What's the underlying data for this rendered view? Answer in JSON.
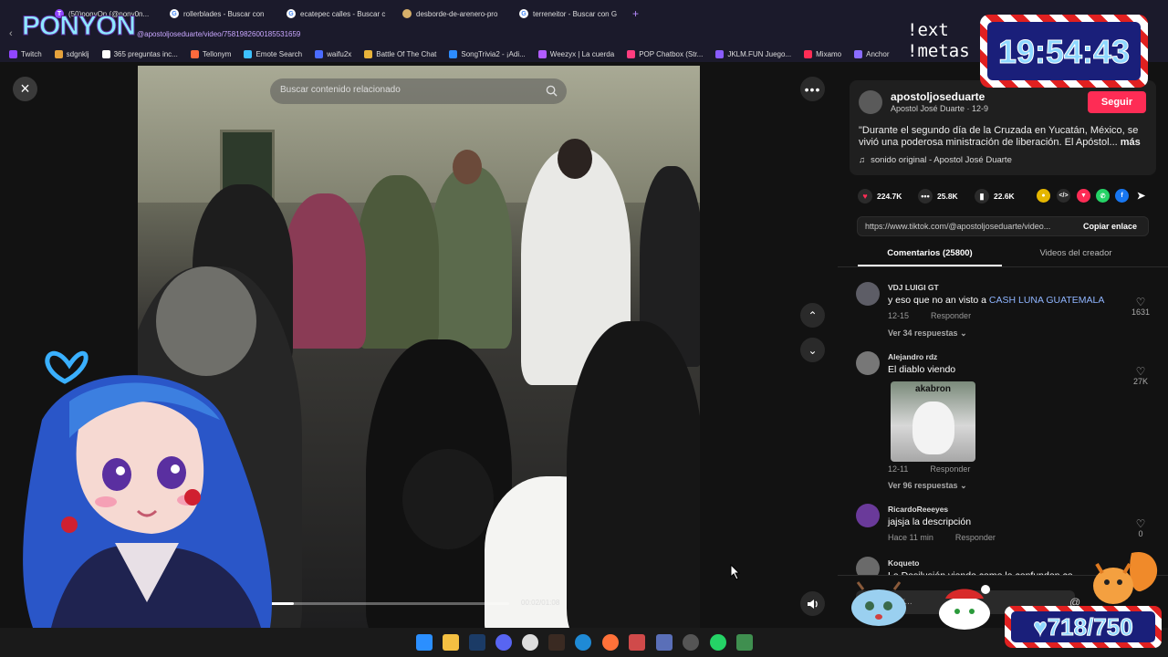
{
  "browser": {
    "tabs": [
      {
        "label": "(50)ponyOn (@pony0n..."
      },
      {
        "label": "rollerblades - Buscar con"
      },
      {
        "label": "ecatepec calles - Buscar c"
      },
      {
        "label": "desborde-de-arenero-pro"
      },
      {
        "label": "terreneitor - Buscar con G"
      }
    ],
    "url": "@apostoljoseduarte/video/7581982600185531659",
    "bookmarks": [
      {
        "label": "Twitch",
        "color": "#9146ff"
      },
      {
        "label": "sdgnklj",
        "color": "#e6a23c"
      },
      {
        "label": "365 preguntas inc...",
        "color": "#ffffff"
      },
      {
        "label": "Tellonym",
        "color": "#ff6a3d"
      },
      {
        "label": "Emote Search",
        "color": "#3dc1ff"
      },
      {
        "label": "waifu2x",
        "color": "#4b6cff"
      },
      {
        "label": "Battle Of The Chat",
        "color": "#e8b33a"
      },
      {
        "label": "SongTrivia2 - ¡Adi...",
        "color": "#2d8cff"
      },
      {
        "label": "Weezyx | La cuerda",
        "color": "#b25cff"
      },
      {
        "label": "POP Chatbox (Str...",
        "color": "#ff3d7f"
      },
      {
        "label": "JKLM.FUN Juego...",
        "color": "#8a5cff"
      },
      {
        "label": "Mixamo",
        "color": "#ff2d55"
      },
      {
        "label": "Anchor",
        "color": "#8a6cff"
      }
    ]
  },
  "overlay": {
    "logo": "PONYON",
    "cmd_line1": "!ext",
    "cmd_line2": "!metas",
    "clock": "19:54:43",
    "counter": "718/750"
  },
  "player": {
    "search_placeholder": "Buscar contenido relacionado",
    "time": "00:02/01:08",
    "progress": 0.1
  },
  "post": {
    "handle": "apostoljoseduarte",
    "subline": "Apostol José Duarte · 12-9",
    "follow_label": "Seguir",
    "description": "\"Durante el segundo día de la Cruzada en Yucatán, México, se vivió una poderosa ministración de liberación. El Apóstol...",
    "more_label": "más",
    "sound": "sonido original - Apostol José Duarte",
    "likes": "224.7K",
    "comments": "25.8K",
    "saves": "22.6K",
    "link": "https://www.tiktok.com/@apostoljoseduarte/video...",
    "copy_label": "Copiar enlace",
    "tab_comments": "Comentarios (25800)",
    "tab_videos": "Videos del creador"
  },
  "comments": [
    {
      "user": "VDJ LUIGI GT",
      "text": "y eso que no an visto a ",
      "link": "CASH LUNA GUATEMALA",
      "date": "12-15",
      "reply": "Responder",
      "likes": "1631",
      "replies": "Ver 34 respuestas"
    },
    {
      "user": "Alejandro rdz",
      "text": "El diablo viendo",
      "meme": "akabron",
      "date": "12-11",
      "reply": "Responder",
      "likes": "27K",
      "replies": "Ver 96 respuestas"
    },
    {
      "user": "RicardoReeeyes",
      "text": "jajsja la descripción",
      "date": "Hace 11 min",
      "reply": "Responder",
      "likes": "0"
    },
    {
      "user": "Koqueto",
      "text": "La Desilusión viendo como la confunden co..."
    }
  ],
  "comment_placeholder": "Comentar...",
  "colors": {
    "accent": "#fe2c55",
    "link": "#8fb5ff"
  }
}
